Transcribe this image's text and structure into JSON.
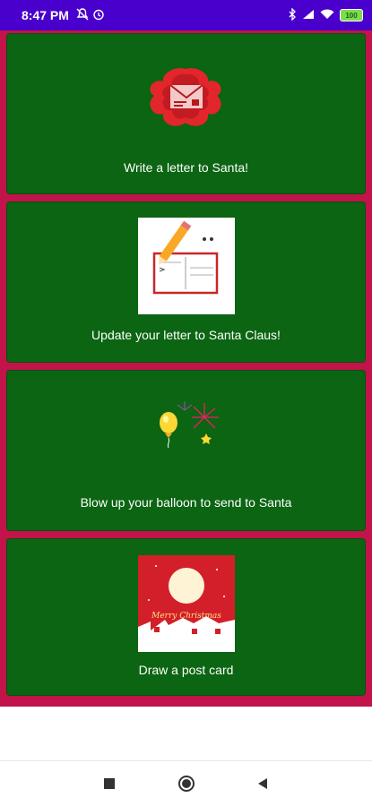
{
  "status_bar": {
    "time": "8:47 PM",
    "icons_left": [
      "mute-icon",
      "alarm-icon"
    ],
    "icons_right": [
      "bluetooth-icon",
      "signal-icon",
      "wifi-icon"
    ],
    "battery_level": "100"
  },
  "cards": [
    {
      "label": "Write a letter to Santa!",
      "image": "envelope-icon"
    },
    {
      "label": "Update your letter to Santa Claus!",
      "image": "postcard-pencil-icon"
    },
    {
      "label": "Blow up your balloon to send to Santa",
      "image": "balloon-fireworks-icon"
    },
    {
      "label": "Draw a post card",
      "image": "merry-christmas-postcard-image",
      "image_text": "Merry Christmas"
    }
  ],
  "colors": {
    "status_bar": "#4a00cc",
    "background": "#c2134a",
    "card": "#0b6512"
  },
  "nav": [
    "recent-apps-button",
    "home-button",
    "back-button"
  ]
}
